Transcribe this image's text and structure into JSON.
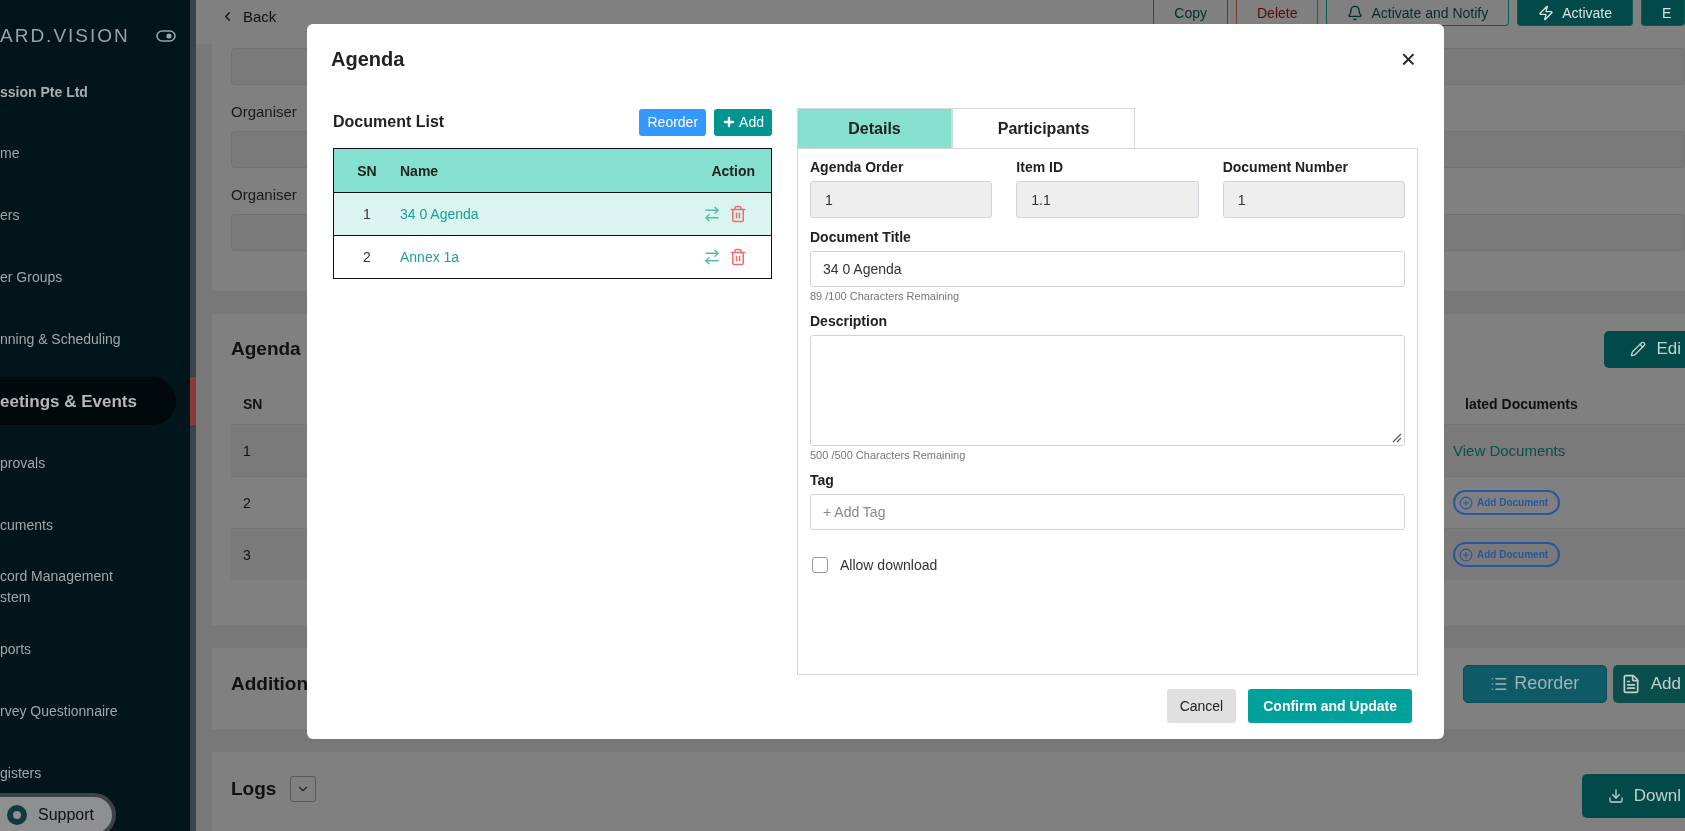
{
  "sidebar": {
    "brand": "ARD.VISION",
    "organization": "ssion Pte Ltd",
    "items": [
      {
        "label": "me",
        "selected": false
      },
      {
        "label": "ers",
        "selected": false
      },
      {
        "label": "er Groups",
        "selected": false
      },
      {
        "label": "nning & Scheduling",
        "selected": false
      },
      {
        "label": "eetings & Events",
        "selected": true
      },
      {
        "label": "provals",
        "selected": false
      },
      {
        "label": "cuments",
        "selected": false
      },
      {
        "label": "cord Management\nstem",
        "selected": false
      },
      {
        "label": "ports",
        "selected": false
      },
      {
        "label": "rvey Questionnaire",
        "selected": false
      },
      {
        "label": "gisters",
        "selected": false
      }
    ],
    "support": "Support"
  },
  "toolbar": {
    "back": "Back",
    "buttons": [
      {
        "label": "Copy",
        "kind": "outline"
      },
      {
        "label": "Delete",
        "kind": "danger"
      },
      {
        "label": "Activate and Notify",
        "kind": "notify"
      },
      {
        "label": "Activate",
        "kind": "activate"
      },
      {
        "label": "E",
        "kind": "filled"
      }
    ]
  },
  "details_card": {
    "labels": [
      "Organiser",
      "Organiser"
    ]
  },
  "agenda_card": {
    "title": "Agenda",
    "edit": "Edi",
    "columns": [
      "SN",
      "lated Documents"
    ],
    "rows": [
      {
        "sn": "1",
        "documents": "View Documents",
        "kind": "link"
      },
      {
        "sn": "2",
        "documents": "Add Document",
        "kind": "add"
      },
      {
        "sn": "3",
        "documents": "Add Document",
        "kind": "add"
      }
    ]
  },
  "additional_card": {
    "title": "Addition",
    "reorder": "Reorder",
    "add": "Add"
  },
  "logs": {
    "title": "Logs",
    "download": "Downl"
  },
  "modal": {
    "title": "Agenda",
    "close": "×",
    "document_list": {
      "title": "Document List",
      "reorder": "Reorder",
      "add": "Add",
      "columns": [
        "SN",
        "Name",
        "Action"
      ],
      "rows": [
        {
          "sn": "1",
          "name": "34 0 Agenda",
          "selected": true
        },
        {
          "sn": "2",
          "name": "Annex 1a",
          "selected": false
        }
      ]
    },
    "tabs": [
      {
        "label": "Details",
        "selected": true
      },
      {
        "label": "Participants",
        "selected": false
      }
    ],
    "fields": [
      {
        "label": "Agenda Order",
        "value": "1"
      },
      {
        "label": "Item ID",
        "value": "1.1"
      },
      {
        "label": "Document Number",
        "value": "1"
      }
    ],
    "document_title": {
      "label": "Document Title",
      "value": "34 0 Agenda",
      "counter": "89 /100 Characters Remaining"
    },
    "description": {
      "label": "Description",
      "counter": "500 /500 Characters Remaining"
    },
    "tag": {
      "label": "Tag",
      "placeholder": "+ Add Tag"
    },
    "allow_download": {
      "label": "Allow download",
      "checked": false
    },
    "cancel": "Cancel",
    "confirm": "Confirm and Update"
  }
}
